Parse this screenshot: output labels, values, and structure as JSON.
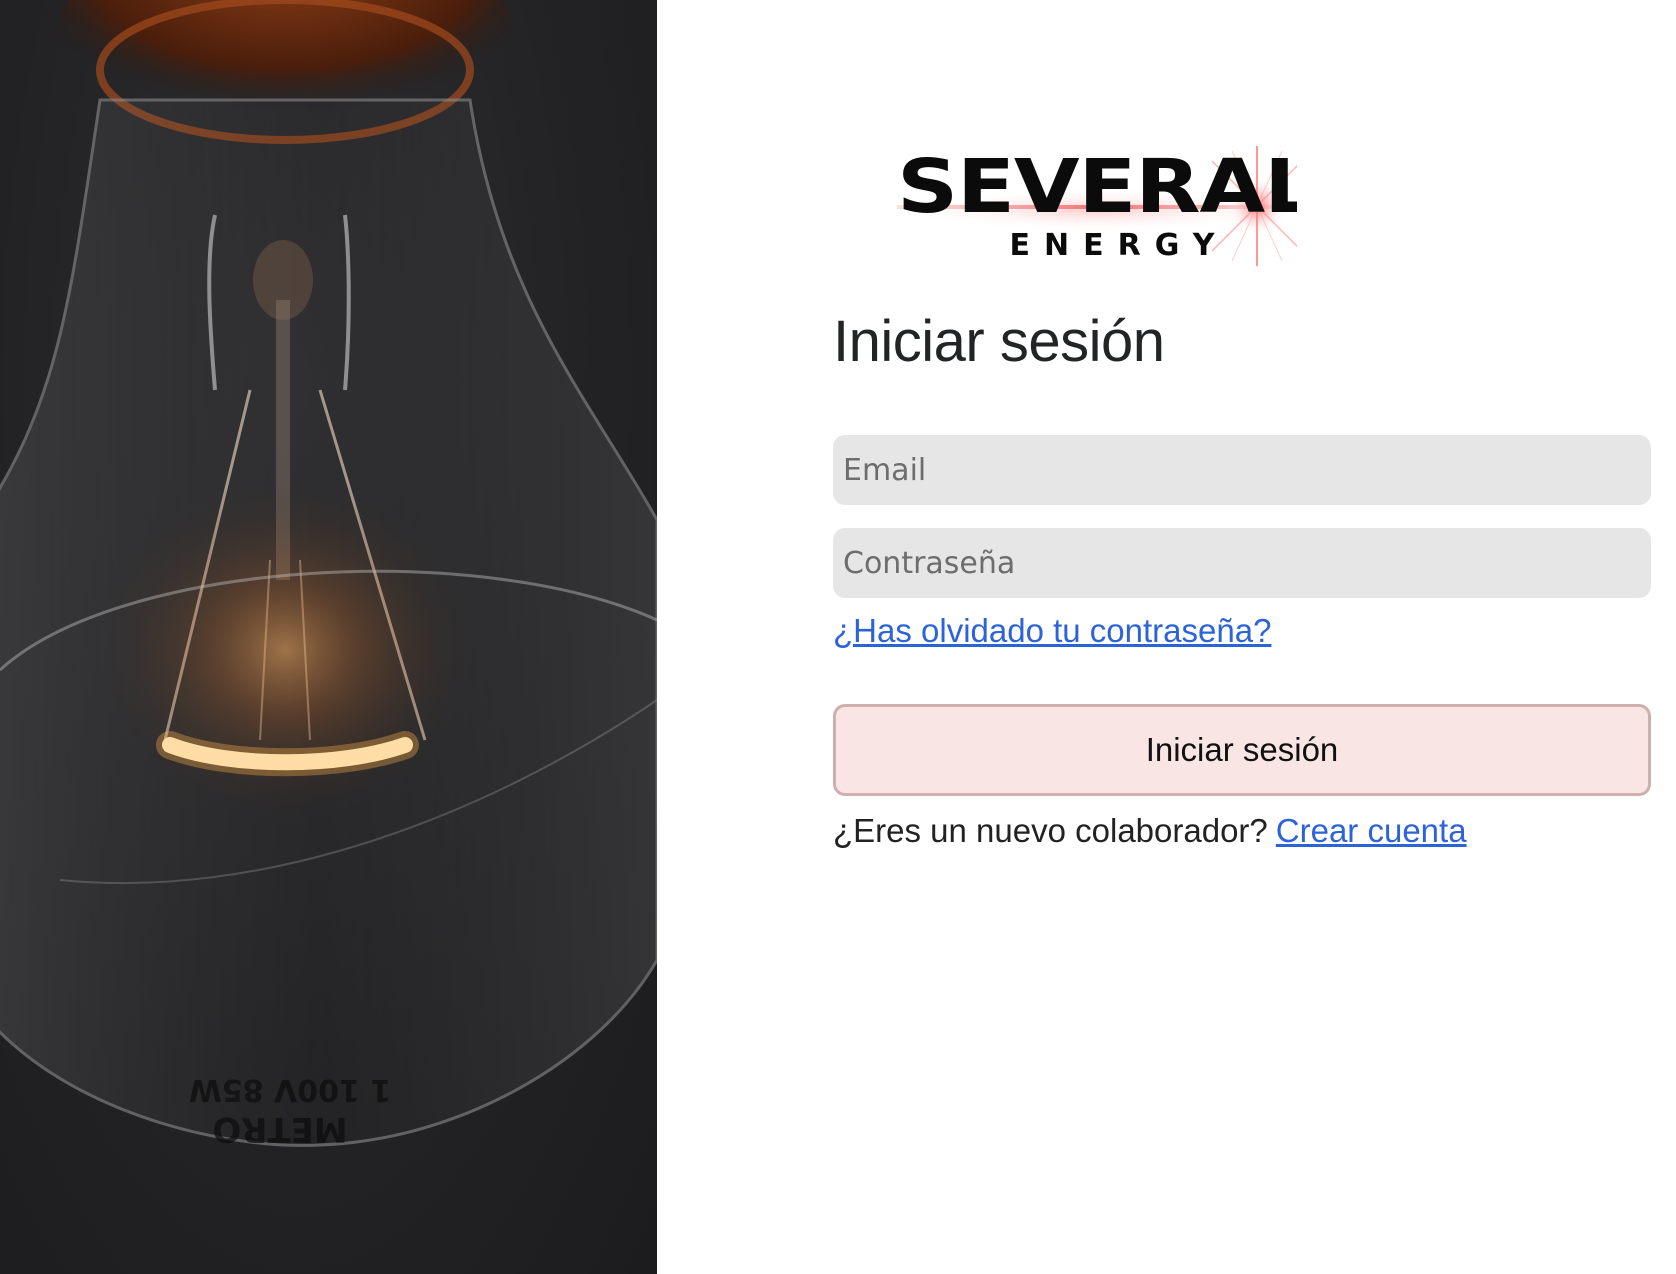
{
  "brand": {
    "name_line1": "SEVERAL",
    "name_line2": "ENERGY",
    "accent_color": "#e8484a"
  },
  "hero": {
    "image_alt": "glowing incandescent light bulb",
    "bulb_print": "1 100V 85W",
    "bulb_print_2": "METRO"
  },
  "login": {
    "title": "Iniciar sesión",
    "email_placeholder": "Email",
    "password_placeholder": "Contraseña",
    "forgot_password": "¿Has olvidado tu contraseña?",
    "submit_label": "Iniciar sesión",
    "new_collaborator_text": "¿Eres un nuevo colaborador?",
    "create_account_link": "Crear cuenta"
  },
  "colors": {
    "input_bg": "#e6e6e6",
    "button_bg": "#f9e6e4",
    "link": "#2d63d8"
  }
}
